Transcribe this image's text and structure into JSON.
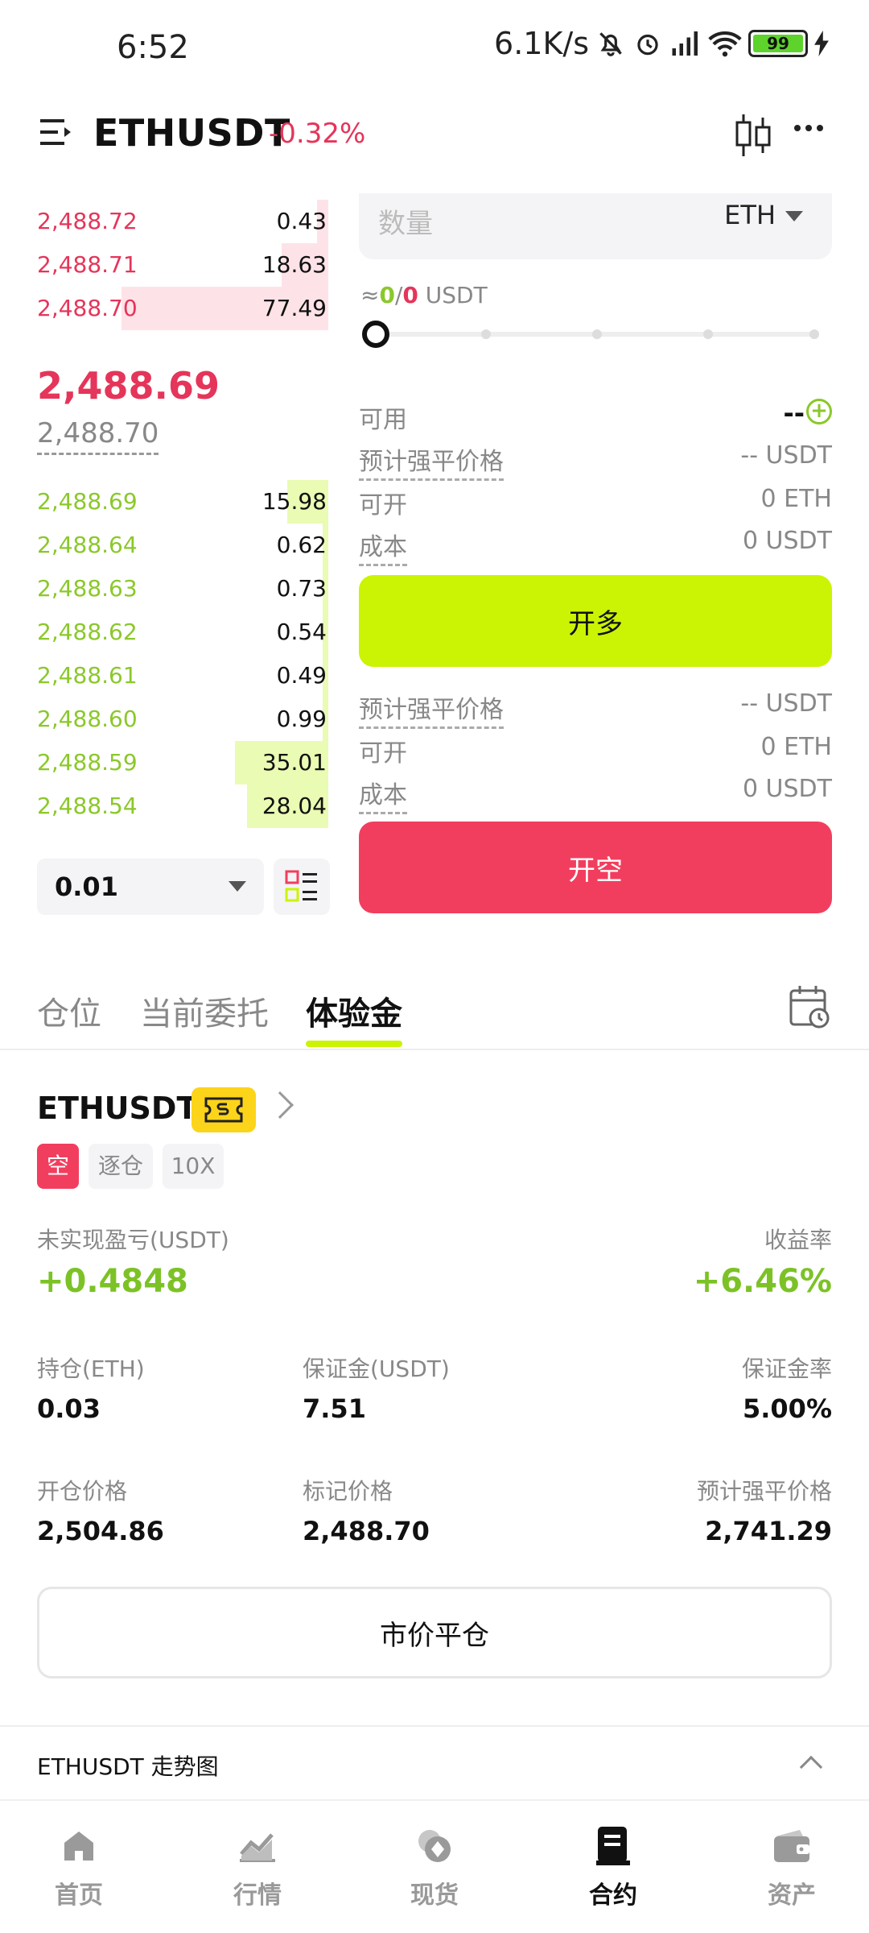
{
  "status": {
    "time": "6:52",
    "speed": "6.1K/s",
    "battery": "99"
  },
  "header": {
    "symbol": "ETHUSDT",
    "change": "-0.32%"
  },
  "orderbook": {
    "asks": [
      {
        "price": "2,488.72",
        "qty": "0.43",
        "depth": 0.04
      },
      {
        "price": "2,488.71",
        "qty": "18.63",
        "depth": 0.16
      },
      {
        "price": "2,488.70",
        "qty": "77.49",
        "depth": 0.71
      }
    ],
    "last_price": "2,488.69",
    "mark_price": "2,488.70",
    "bids": [
      {
        "price": "2,488.69",
        "qty": "15.98",
        "depth": 0.14
      },
      {
        "price": "2,488.64",
        "qty": "0.62",
        "depth": 0.02
      },
      {
        "price": "2,488.63",
        "qty": "0.73",
        "depth": 0.02
      },
      {
        "price": "2,488.62",
        "qty": "0.54",
        "depth": 0.02
      },
      {
        "price": "2,488.61",
        "qty": "0.49",
        "depth": 0.02
      },
      {
        "price": "2,488.60",
        "qty": "0.99",
        "depth": 0.02
      },
      {
        "price": "2,488.59",
        "qty": "35.01",
        "depth": 0.32
      },
      {
        "price": "2,488.54",
        "qty": "28.04",
        "depth": 0.28
      }
    ],
    "step": "0.01"
  },
  "form": {
    "qty_placeholder": "数量",
    "qty_unit": "ETH",
    "approx_prefix": "≈",
    "approx_long": "0",
    "approx_sep": "/",
    "approx_short": "0",
    "approx_unit": " USDT",
    "slider_value": 0,
    "available_label": "可用",
    "available_value": "--",
    "long": {
      "liq_label": "预计强平价格",
      "liq_value": "-- USDT",
      "open_label": "可开",
      "open_value": "0 ETH",
      "cost_label": "成本",
      "cost_value": "0 USDT",
      "button": "开多"
    },
    "short": {
      "liq_label": "预计强平价格",
      "liq_value": "-- USDT",
      "open_label": "可开",
      "open_value": "0 ETH",
      "cost_label": "成本",
      "cost_value": "0 USDT",
      "button": "开空"
    }
  },
  "tabs": [
    "仓位",
    "当前委托",
    "体验金"
  ],
  "position": {
    "symbol": "ETHUSDT",
    "side": "空",
    "margin_mode": "逐仓",
    "leverage": "10X",
    "pnl_label": "未实现盈亏(USDT)",
    "pnl_value": "+0.4848",
    "roe_label": "收益率",
    "roe_value": "+6.46%",
    "size_label": "持仓(ETH)",
    "size_value": "0.03",
    "margin_label": "保证金(USDT)",
    "margin_value": "7.51",
    "margin_rate_label": "保证金率",
    "margin_rate_value": "5.00%",
    "entry_label": "开仓价格",
    "entry_value": "2,504.86",
    "mark_label": "标记价格",
    "mark_value": "2,488.70",
    "liq_label": "预计强平价格",
    "liq_value": "2,741.29",
    "close_button": "市价平仓"
  },
  "trend_title": "ETHUSDT 走势图",
  "nav": [
    "首页",
    "行情",
    "现货",
    "合约",
    "资产"
  ],
  "colors": {
    "up": "#8bc82a",
    "down": "#e5355a",
    "accent": "#cbf304"
  }
}
